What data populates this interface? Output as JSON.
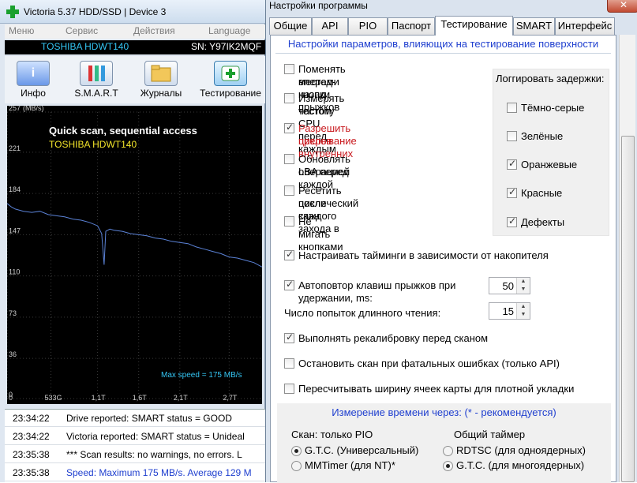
{
  "main_window": {
    "title": "Victoria 5.37 HDD/SSD | Device 3",
    "menu": [
      "Меню",
      "Сервис",
      "Действия",
      "Language"
    ],
    "drive_model": "TOSHIBA HDWT140",
    "drive_sn": "SN: Y97IK2MQF",
    "toolbar": [
      "Инфо",
      "S.M.A.R.T",
      "Журналы",
      "Тестирование"
    ],
    "scan_title": "Quick scan, sequential access",
    "scan_drive": "TOSHIBA HDWT140",
    "max_speed_text": "Max speed = 175 MB/s",
    "log": [
      {
        "time": "23:34:22",
        "text": "Drive reported: SMART status = GOOD",
        "color": "#000000"
      },
      {
        "time": "23:34:22",
        "text": "Victoria reported: SMART status = Unideal",
        "color": "#000000"
      },
      {
        "time": "23:35:38",
        "text": "*** Scan results: no warnings, no errors. L",
        "color": "#000000"
      },
      {
        "time": "23:35:38",
        "text": "Speed: Maximum 175 MB/s. Average 129 M",
        "color": "#1f3fcf"
      }
    ]
  },
  "chart_data": {
    "type": "line",
    "ylabel": "(MB/s)",
    "y_ticks": [
      "257",
      "221",
      "184",
      "147",
      "110",
      "73",
      "36",
      "0"
    ],
    "x_ticks": [
      "0",
      "533G",
      "1,1T",
      "1,6T",
      "2,1T",
      "2,7T"
    ],
    "ylim": [
      0,
      257
    ],
    "xlim": [
      0,
      3.1
    ],
    "grid": true,
    "series": [
      {
        "color": "#5b82d6",
        "x": [
          0,
          0.05,
          0.1,
          0.2,
          0.3,
          0.4,
          0.5,
          0.6,
          0.7,
          0.8,
          0.9,
          1.0,
          1.1,
          1.15,
          1.18,
          1.2,
          1.25,
          1.3,
          1.4,
          1.5,
          1.6,
          1.7,
          1.8,
          1.9,
          2.0,
          2.1,
          2.2,
          2.3,
          2.4,
          2.5,
          2.6,
          2.7,
          2.8,
          2.9,
          3.0,
          3.1
        ],
        "y": [
          175,
          172,
          170,
          168,
          167,
          168,
          165,
          164,
          163,
          161,
          160,
          158,
          155,
          148,
          120,
          150,
          152,
          151,
          150,
          148,
          147,
          146,
          144,
          143,
          141,
          140,
          139,
          136,
          134,
          132,
          130,
          127,
          126,
          124,
          122,
          118
        ]
      }
    ]
  },
  "dialog": {
    "title": "Настройки программы",
    "tabs": [
      "Общие",
      "API",
      "PIO",
      "Паспорт",
      "Тестирование",
      "SMART",
      "Интерфейс"
    ],
    "active_tab": "Тестирование",
    "section_header": "Настройки параметров, влияющих на тестирование поверхности",
    "options": [
      {
        "label": "Поменять местами кнопки прыжков вперед-назад",
        "line1": "Поменять местами кнопки прыжков",
        "line2": "вперед-назад",
        "checked": false,
        "color": "#000000"
      },
      {
        "label": "Измерять частоту CPU перед каждым тестом",
        "line1": "Измерять частоту CPU перед каждым",
        "line2": "тестом",
        "checked": false,
        "color": "#000000"
      },
      {
        "label": "Разрешить прерывание внутренних циклов",
        "line1": "Разрешить прерывание внутренних",
        "line2": "циклов",
        "checked": true,
        "color": "#c8191e"
      },
      {
        "label": "Обновлять LBA перед каждой операцией",
        "line1": "Обновлять LBA перед каждой",
        "line2": "операцией",
        "checked": false,
        "color": "#000000"
      },
      {
        "label": "Ресетить после каждого захода в циклический скан",
        "line1": "Ресетить после каждого захода в",
        "line2": "циклический скан",
        "checked": false,
        "color": "#000000"
      },
      {
        "label": "Не мигать кнопками",
        "line1": "Не мигать кнопками",
        "line2": "",
        "checked": false,
        "color": "#000000"
      }
    ],
    "log_delays": {
      "title": "Логгировать задержки:",
      "items": [
        {
          "label": "Тёмно-серые",
          "checked": false
        },
        {
          "label": "Зелёные",
          "checked": false
        },
        {
          "label": "Оранжевые",
          "checked": true
        },
        {
          "label": "Красные",
          "checked": true
        },
        {
          "label": "Дефекты",
          "checked": true
        }
      ]
    },
    "timings": {
      "label": "Настраивать тайминги в зависимости от накопителя",
      "checked": true
    },
    "autorepeat": {
      "line1": "Автоповтор клавиш прыжков при",
      "line2": "удержании, ms:",
      "checked": true,
      "value": "50"
    },
    "long_read": {
      "label": "Число попыток длинного чтения:",
      "value": "15"
    },
    "recalibrate": {
      "label": "Выполнять рекалибровку перед сканом",
      "checked": true
    },
    "stop_scan": {
      "label": "Остановить скан при фатальных ошибках (только API)",
      "checked": false
    },
    "recalc_width": {
      "label": "Пересчитывать ширину ячеек карты для плотной укладки",
      "checked": false
    },
    "timing_section": {
      "header": "Измерение времени через: (* - рекомендуется)",
      "left_title": "Скан: только PIO",
      "left_options": [
        {
          "label": "G.T.C. (Универсальный)",
          "selected": true
        },
        {
          "label": "MMTimer (для NT)*",
          "selected": false
        }
      ],
      "right_title": "Общий таймер",
      "right_options": [
        {
          "label": "RDTSC (для одноядерных)",
          "selected": false
        },
        {
          "label": "G.T.C. (для многоядерных)",
          "selected": true
        }
      ]
    }
  }
}
